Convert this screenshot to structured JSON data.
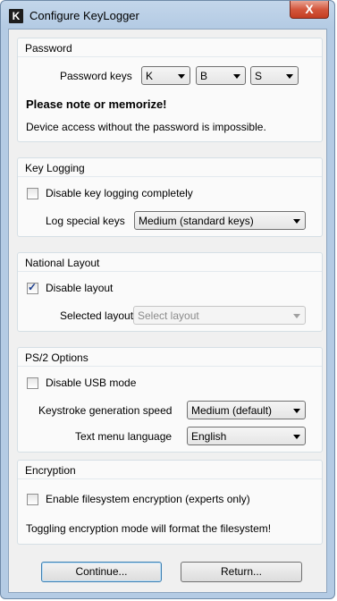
{
  "window": {
    "title": "Configure KeyLogger",
    "icon_letter": "K",
    "close_symbol": "X"
  },
  "password": {
    "group_title": "Password",
    "keys_label": "Password keys",
    "keys": [
      "K",
      "B",
      "S"
    ],
    "note": "Please note or memorize!",
    "warning": "Device access without the password is impossible."
  },
  "key_logging": {
    "group_title": "Key Logging",
    "disable_label": "Disable key logging completely",
    "disable_checked": false,
    "special_label": "Log special keys",
    "special_value": "Medium (standard keys)"
  },
  "national_layout": {
    "group_title": "National Layout",
    "disable_label": "Disable layout",
    "disable_checked": true,
    "selected_label": "Selected layout",
    "selected_placeholder": "Select layout"
  },
  "ps2": {
    "group_title": "PS/2 Options",
    "disable_usb_label": "Disable USB mode",
    "disable_usb_checked": false,
    "speed_label": "Keystroke generation speed",
    "speed_value": "Medium (default)",
    "language_label": "Text menu language",
    "language_value": "English"
  },
  "encryption": {
    "group_title": "Encryption",
    "enable_label": "Enable filesystem encryption (experts only)",
    "enable_checked": false,
    "warning": "Toggling encryption mode will format the filesystem!"
  },
  "buttons": {
    "continue": "Continue...",
    "return": "Return..."
  }
}
